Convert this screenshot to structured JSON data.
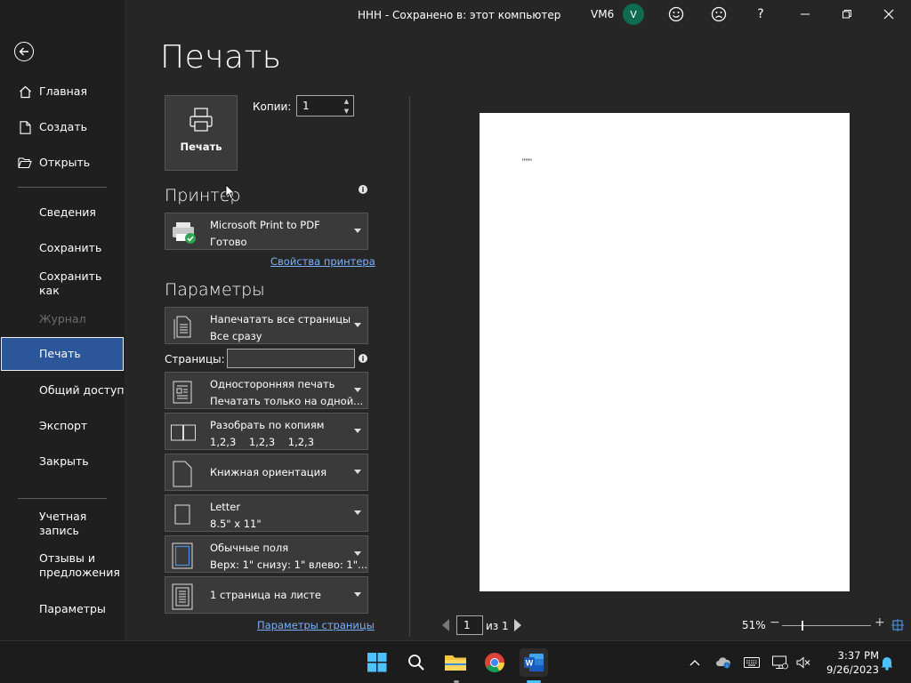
{
  "window": {
    "title": "ННН - Сохранено в: этот компьютер",
    "user_label": "VM6",
    "avatar_letter": "V"
  },
  "sidebar": {
    "items": [
      {
        "label": "Главная",
        "icon": "home-icon"
      },
      {
        "label": "Создать",
        "icon": "new-document-icon"
      },
      {
        "label": "Открыть",
        "icon": "folder-open-icon"
      },
      {
        "label": "Сведения"
      },
      {
        "label": "Сохранить"
      },
      {
        "label": "Сохранить как"
      },
      {
        "label": "Журнал",
        "disabled": true
      },
      {
        "label": "Печать",
        "active": true
      },
      {
        "label": "Общий доступ"
      },
      {
        "label": "Экспорт"
      },
      {
        "label": "Закрыть"
      },
      {
        "label": "Учетная запись"
      },
      {
        "label": "Отзывы и предложения"
      },
      {
        "label": "Параметры"
      }
    ]
  },
  "main": {
    "title": "Печать",
    "print_button_label": "Печать",
    "copies_label": "Копии:",
    "copies_value": "1",
    "printer_heading": "Принтер",
    "printer": {
      "name": "Microsoft Print to PDF",
      "status": "Готово"
    },
    "printer_properties_link": "Свойства принтера",
    "settings_heading": "Параметры",
    "pages_label": "Страницы:",
    "pages_value": "",
    "settings": [
      {
        "line1": "Напечатать все страницы",
        "line2": "Все сразу",
        "icon": "pages-icon"
      },
      {
        "line1": "Односторонняя печать",
        "line2": "Печатать только на одной...",
        "icon": "one-sided-icon"
      },
      {
        "line1": "Разобрать по копиям",
        "line2": "1,2,3    1,2,3    1,2,3",
        "icon": "collated-icon"
      },
      {
        "line1": "Книжная ориентация",
        "line2": "",
        "icon": "portrait-icon"
      },
      {
        "line1": "Letter",
        "line2": "8.5\" x 11\"",
        "icon": "paper-size-icon"
      },
      {
        "line1": "Обычные поля",
        "line2": "Верх: 1\" снизу: 1\" влево: 1\"...",
        "icon": "margins-icon"
      },
      {
        "line1": "1 страница на листе",
        "line2": "",
        "icon": "pages-per-sheet-icon"
      }
    ],
    "page_setup_link": "Параметры страницы"
  },
  "preview": {
    "page_text": "ннн",
    "current_page": "1",
    "of_label": "из 1",
    "zoom": "51%",
    "zoom_level": 0.51
  },
  "taskbar": {
    "time": "3:37 PM",
    "date": "9/26/2023"
  },
  "colors": {
    "accent": "#2b579a",
    "background": "#262626",
    "sidebar": "#1f1f1f",
    "link": "#7cb1ff"
  }
}
